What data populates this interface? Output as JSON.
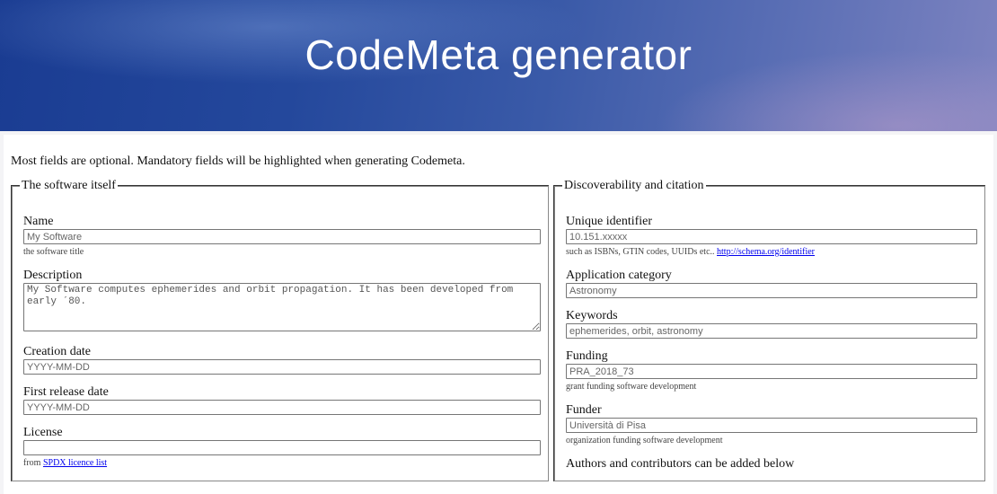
{
  "header": {
    "title": "CodeMeta generator"
  },
  "intro": "Most fields are optional. Mandatory fields will be highlighted when generating Codemeta.",
  "software_section": {
    "legend": "The software itself",
    "name": {
      "label": "Name",
      "placeholder": "My Software",
      "help": "the software title"
    },
    "description": {
      "label": "Description",
      "placeholder": "My Software computes ephemerides and orbit propagation. It has been developed from early ´80."
    },
    "creation_date": {
      "label": "Creation date",
      "placeholder": "YYYY-MM-DD"
    },
    "first_release_date": {
      "label": "First release date",
      "placeholder": "YYYY-MM-DD"
    },
    "license": {
      "label": "License",
      "placeholder": "",
      "help_prefix": "from",
      "help_link": "SPDX licence list"
    }
  },
  "discoverability_section": {
    "legend": "Discoverability and citation",
    "identifier": {
      "label": "Unique identifier",
      "placeholder": "10.151.xxxxx",
      "help": "such as ISBNs, GTIN codes, UUIDs etc..",
      "help_link": "http://schema.org/identifier"
    },
    "application_category": {
      "label": "Application category",
      "placeholder": "Astronomy"
    },
    "keywords": {
      "label": "Keywords",
      "placeholder": "ephemerides, orbit, astronomy"
    },
    "funding": {
      "label": "Funding",
      "placeholder": "PRA_2018_73",
      "help": "grant funding software development"
    },
    "funder": {
      "label": "Funder",
      "placeholder": "Università di Pisa",
      "help": "organization funding software development"
    },
    "authors_note": "Authors and contributors can be added below"
  }
}
